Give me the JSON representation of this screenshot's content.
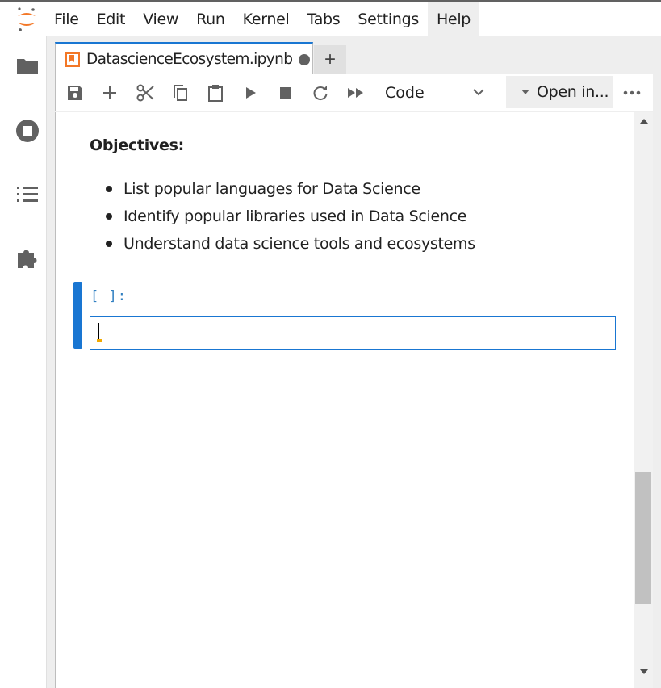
{
  "menubar": {
    "items": [
      "File",
      "Edit",
      "View",
      "Run",
      "Kernel",
      "Tabs",
      "Settings",
      "Help"
    ],
    "active": "Help"
  },
  "sidebar": {
    "icons": [
      "folder-icon",
      "running-stop-icon",
      "table-of-contents-icon",
      "extension-puzzle-icon"
    ]
  },
  "tabs": {
    "active_label": "DatascienceEcosystem.ipynb",
    "modified": true,
    "add_label": "+"
  },
  "toolbar": {
    "buttons": [
      "save-icon",
      "insert-cell-icon",
      "cut-icon",
      "copy-icon",
      "paste-icon",
      "run-icon",
      "stop-icon",
      "restart-icon",
      "fast-forward-icon"
    ],
    "cell_type": "Code",
    "open_in_label": "Open in...",
    "more_label": "..."
  },
  "notebook": {
    "heading": "Objectives:",
    "objectives": [
      "List popular languages for Data Science",
      "Identify popular libraries used in Data Science",
      "Understand data science tools and ecosystems"
    ],
    "code_prompt": "[ ]:",
    "code_value": ""
  },
  "colors": {
    "accent": "#1976d2",
    "prompt": "#307fc1",
    "jupyter_orange": "#f37726"
  }
}
